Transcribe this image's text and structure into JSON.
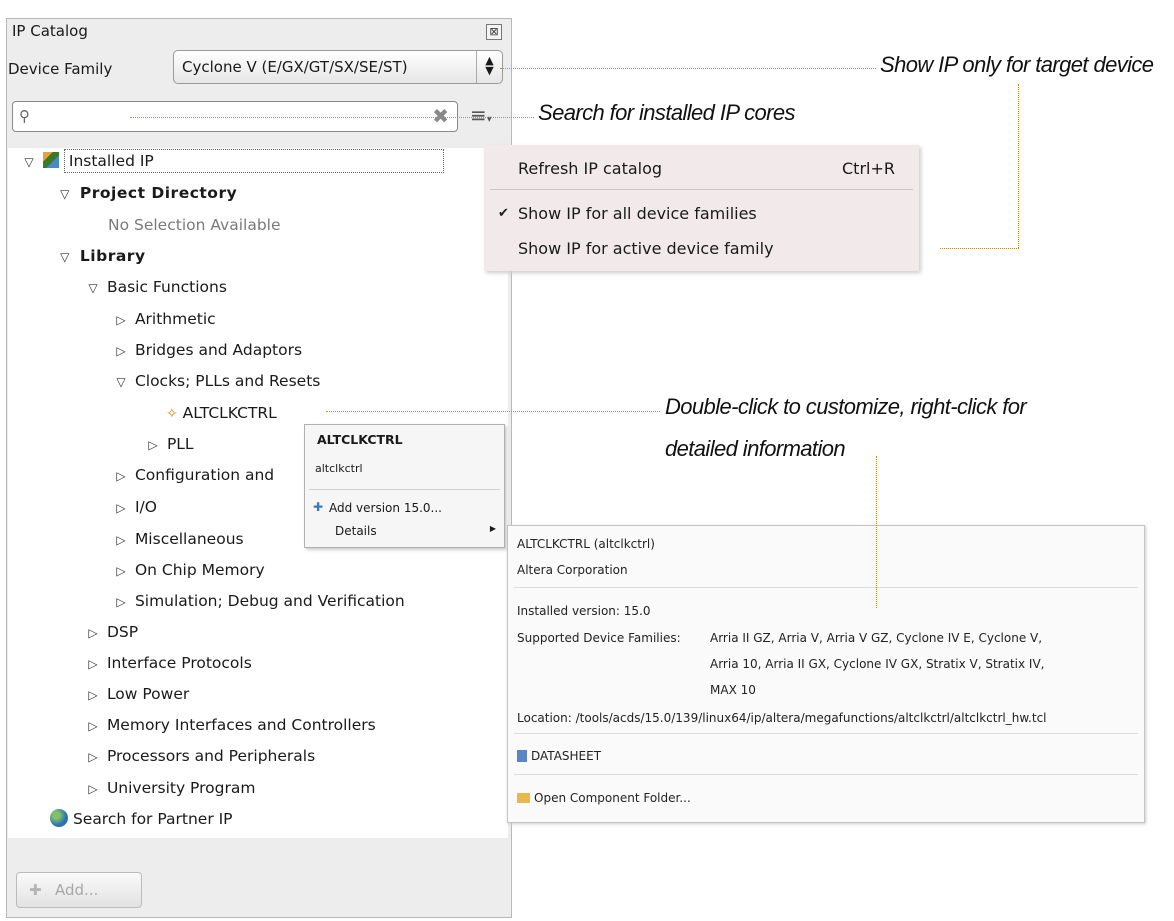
{
  "panel": {
    "title": "IP Catalog",
    "close_symbol": "⊠",
    "device_family_label": "Device Family",
    "device_family_value": "Cyclone V (E/GX/GT/SX/SE/ST)",
    "search": {
      "value": "",
      "placeholder": ""
    },
    "add_button_label": "Add..."
  },
  "tree": {
    "installed_ip": "Installed IP",
    "project_directory": "Project Directory",
    "no_selection": "No Selection Available",
    "library": "Library",
    "basic_functions": "Basic Functions",
    "arithmetic": "Arithmetic",
    "bridges": "Bridges and Adaptors",
    "clocks": "Clocks; PLLs and Resets",
    "altclkctrl": "ALTCLKCTRL",
    "pll": "PLL",
    "configuration": "Configuration and",
    "io": "I/O",
    "misc": "Miscellaneous",
    "on_chip": "On Chip Memory",
    "simulation": "Simulation; Debug and Verification",
    "dsp": "DSP",
    "interface": "Interface Protocols",
    "low_power": "Low Power",
    "memory_interfaces": "Memory Interfaces and Controllers",
    "processors": "Processors and Peripherals",
    "university": "University Program",
    "partner": "Search for Partner IP"
  },
  "dropdown_menu": {
    "refresh": "Refresh IP catalog",
    "refresh_shortcut": "Ctrl+R",
    "show_all": "Show IP for all device families",
    "show_active": "Show IP for active device family",
    "checked_item": "show_all"
  },
  "context_menu": {
    "title": "ALTCLKCTRL",
    "subtitle": "altclkctrl",
    "add_version": "Add version 15.0...",
    "details": "Details"
  },
  "details_popup": {
    "name": "ALTCLKCTRL (altclkctrl)",
    "vendor": "Altera Corporation",
    "installed_version": "Installed version: 15.0",
    "families_label": "Supported Device Families:",
    "families_line1": "Arria II GZ, Arria V, Arria V GZ, Cyclone IV E, Cyclone V,",
    "families_line2": "Arria 10, Arria II GX, Cyclone IV GX, Stratix V, Stratix IV,",
    "families_line3": "MAX 10",
    "location": "Location: /tools/acds/15.0/139/linux64/ip/altera/megafunctions/altclkctrl/altclkctrl_hw.tcl",
    "datasheet": "DATASHEET",
    "open_folder": "Open Component Folder..."
  },
  "callouts": {
    "target_device": "Show IP only for target device",
    "search": "Search for installed IP cores",
    "double_click_line1": "Double-click to customize, right-click for",
    "double_click_line2": "detailed information"
  },
  "colors": {
    "callout_line": "#d4891a",
    "menu_bg": "#f2eaea",
    "panel_bg": "#ededed"
  }
}
